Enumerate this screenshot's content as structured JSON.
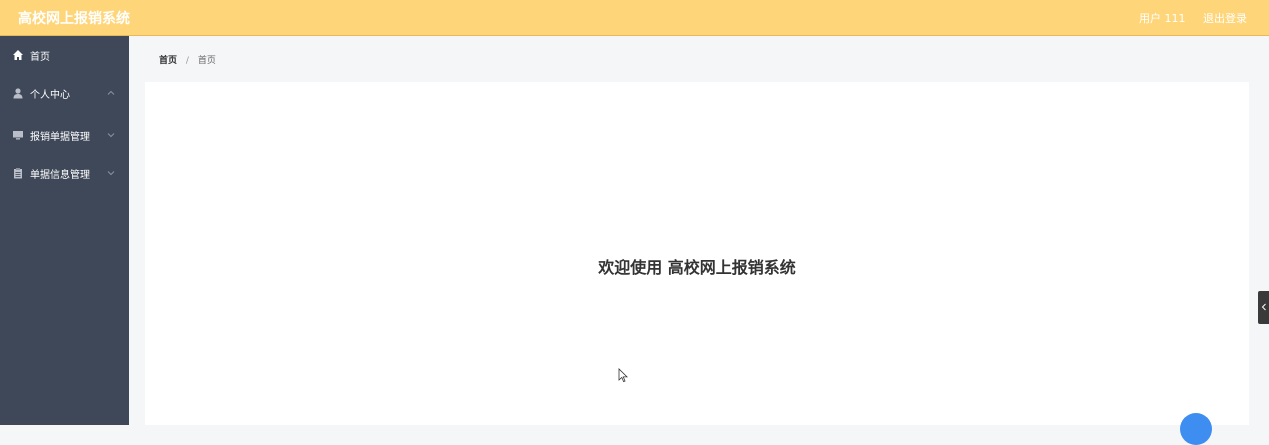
{
  "header": {
    "title": "高校网上报销系统",
    "user_label": "用户 111",
    "logout_label": "退出登录",
    "bg_color": "#ffd57a"
  },
  "sidebar": {
    "bg_color": "#3f4858",
    "items": [
      {
        "label": "首页",
        "icon": "home-icon"
      },
      {
        "label": "个人中心",
        "icon": "user-icon",
        "expanded": true
      },
      {
        "label": "报销单据管理",
        "icon": "monitor-icon",
        "expanded": false
      },
      {
        "label": "单据信息管理",
        "icon": "clipboard-icon",
        "expanded": false
      }
    ]
  },
  "breadcrumb": {
    "home": "首页",
    "separator": "/",
    "current": "首页"
  },
  "main": {
    "welcome_text": "欢迎使用 高校网上报销系统"
  }
}
